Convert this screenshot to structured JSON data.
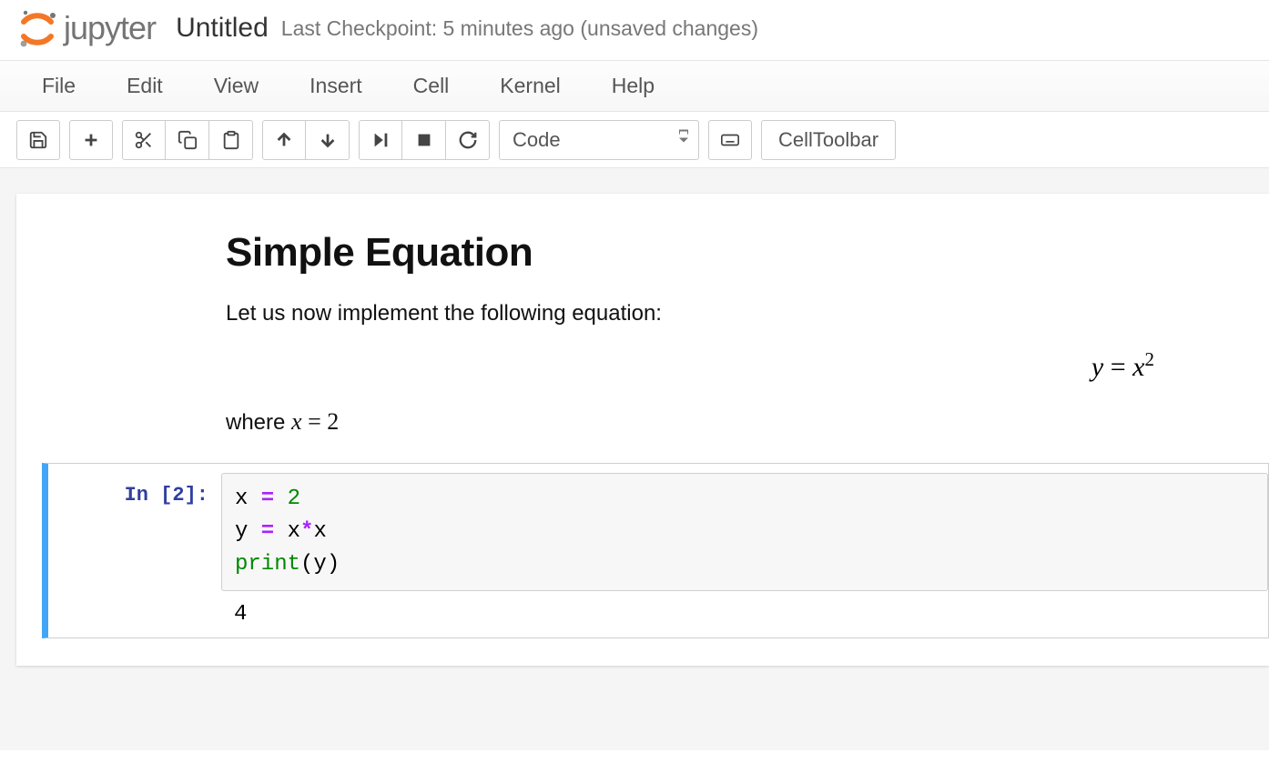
{
  "header": {
    "logo_text": "jupyter",
    "notebook_name": "Untitled",
    "checkpoint": "Last Checkpoint: 5 minutes ago (unsaved changes)"
  },
  "menubar": {
    "items": [
      "File",
      "Edit",
      "View",
      "Insert",
      "Cell",
      "Kernel",
      "Help"
    ]
  },
  "toolbar": {
    "save_icon": "save",
    "add_icon": "plus",
    "cut_icon": "scissors",
    "copy_icon": "copy",
    "paste_icon": "paste",
    "up_icon": "arrow-up",
    "down_icon": "arrow-down",
    "run_icon": "step-forward",
    "stop_icon": "stop",
    "restart_icon": "refresh",
    "cell_type_selected": "Code",
    "keyboard_icon": "keyboard",
    "cell_toolbar_label": "CellToolbar"
  },
  "cells": {
    "markdown": {
      "heading": "Simple Equation",
      "intro": "Let us now implement the following equation:",
      "equation_lhs": "y",
      "equation_eq": " = ",
      "equation_rhs_base": "x",
      "equation_rhs_exp": "2",
      "where_prefix": "where ",
      "where_var": "x",
      "where_eq": " = ",
      "where_val": "2"
    },
    "code": {
      "prompt": "In [2]:",
      "line1_lhs": "x",
      "line1_op": " = ",
      "line1_val": "2",
      "line2_lhs": "y",
      "line2_op": " = ",
      "line2_a": "x",
      "line2_star": "*",
      "line2_b": "x",
      "line3_fn": "print",
      "line3_open": "(",
      "line3_arg": "y",
      "line3_close": ")",
      "output": "4"
    }
  }
}
